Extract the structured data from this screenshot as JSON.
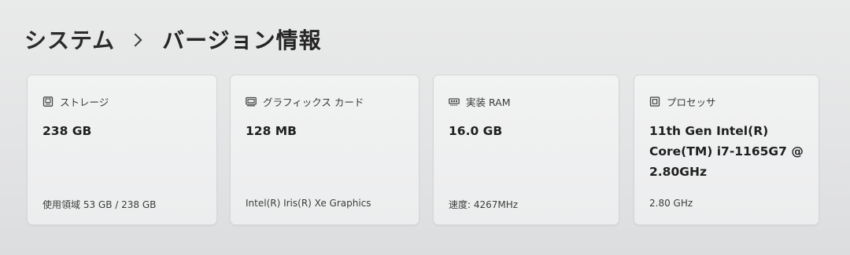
{
  "breadcrumb": {
    "parent": "システム",
    "current": "バージョン情報"
  },
  "cards": {
    "storage": {
      "icon": "storage-icon",
      "title": "ストレージ",
      "value": "238 GB",
      "sub": "使用領域 53 GB / 238 GB"
    },
    "graphics": {
      "icon": "graphics-card-icon",
      "title": "グラフィックス カード",
      "value": "128 MB",
      "sub": "Intel(R) Iris(R) Xe Graphics"
    },
    "ram": {
      "icon": "ram-icon",
      "title": "実装 RAM",
      "value": "16.0 GB",
      "sub": "速度: 4267MHz"
    },
    "processor": {
      "icon": "processor-icon",
      "title": "プロセッサ",
      "value": "11th Gen Intel(R)\nCore(TM) i7-1165G7 @\n2.80GHz",
      "sub": "2.80 GHz"
    }
  }
}
